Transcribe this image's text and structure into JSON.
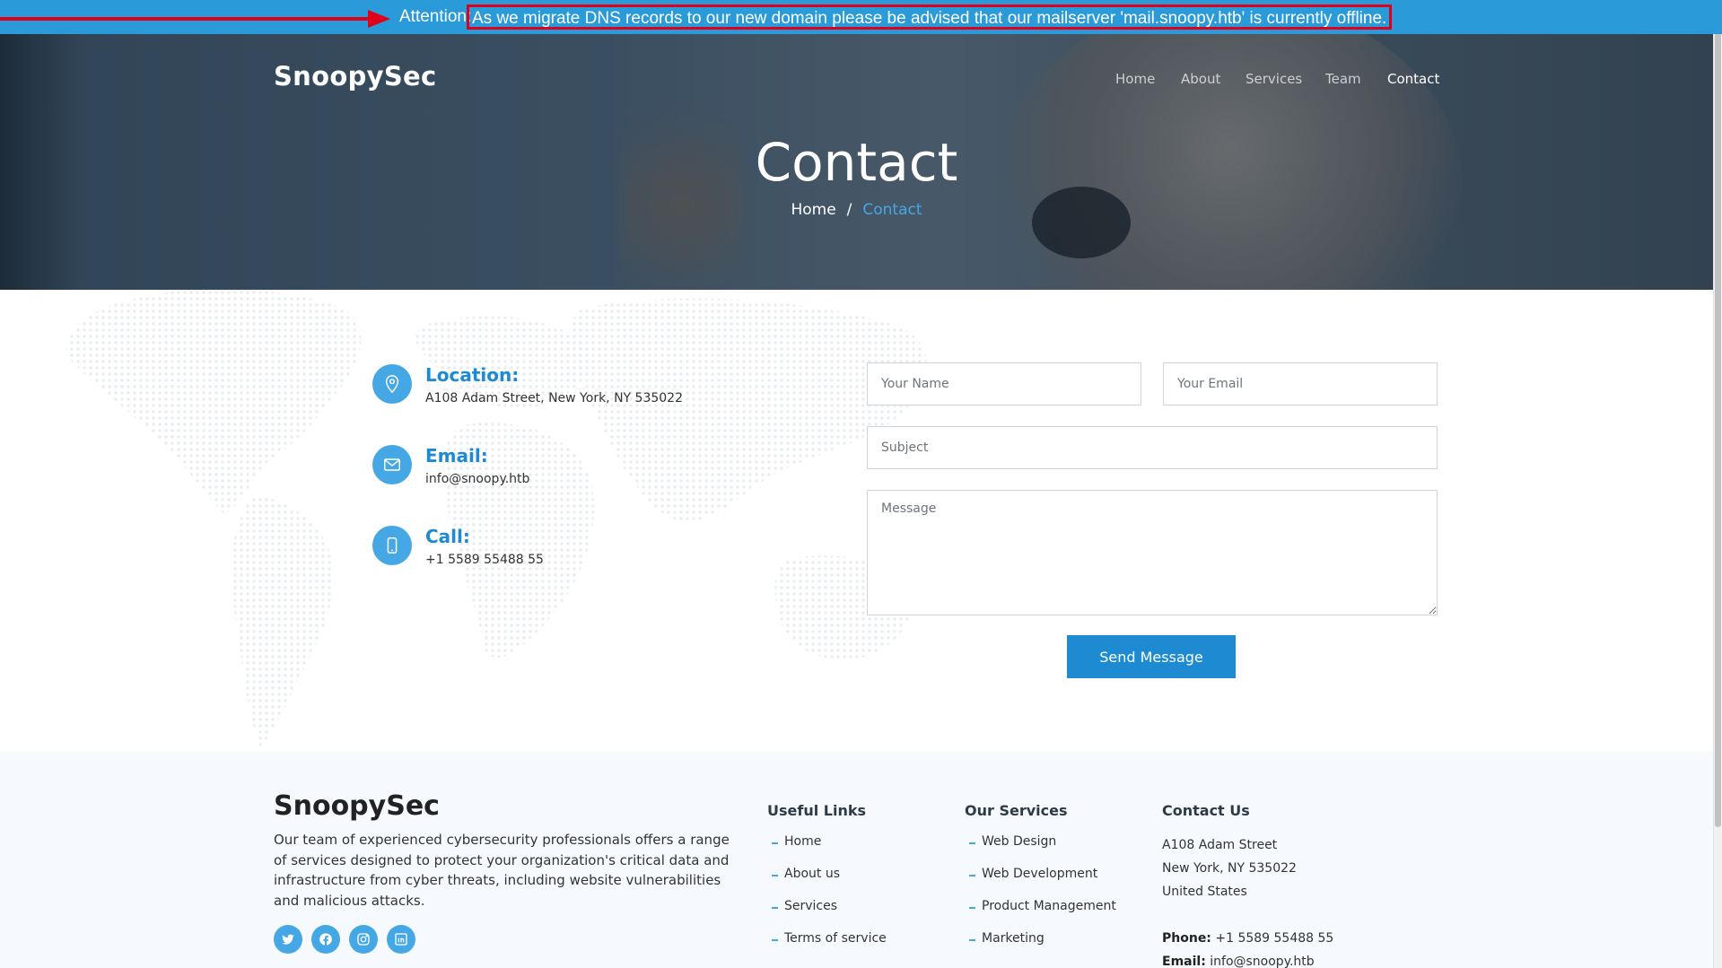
{
  "attention": {
    "label": "Attention:",
    "message": "As we migrate DNS records to our new domain please be advised that our mailserver 'mail.snoopy.htb' is currently offline."
  },
  "brand": {
    "name": "SnoopySec"
  },
  "nav": {
    "items": [
      {
        "label": "Home"
      },
      {
        "label": "About"
      },
      {
        "label": "Services"
      },
      {
        "label": "Team"
      },
      {
        "label": "Contact"
      }
    ],
    "active": "Contact"
  },
  "hero": {
    "title": "Contact",
    "breadcrumb": {
      "home": "Home",
      "separator": "/",
      "current": "Contact"
    }
  },
  "contact_info": {
    "location": {
      "title": "Location:",
      "value": "A108 Adam Street, New York, NY 535022",
      "icon": "map-pin-icon"
    },
    "email": {
      "title": "Email:",
      "value": "info@snoopy.htb",
      "icon": "envelope-icon"
    },
    "call": {
      "title": "Call:",
      "value": "+1 5589 55488 55",
      "icon": "phone-icon"
    }
  },
  "form": {
    "name_placeholder": "Your Name",
    "email_placeholder": "Your Email",
    "subject_placeholder": "Subject",
    "message_placeholder": "Message",
    "submit_label": "Send Message"
  },
  "footer": {
    "brand": "SnoopySec",
    "about": "Our team of experienced cybersecurity professionals offers a range of services designed to protect your organization's critical data and infrastructure from cyber threats, including website vulnerabilities and malicious attacks.",
    "socials": [
      "twitter-icon",
      "facebook-icon",
      "instagram-icon",
      "linkedin-icon"
    ],
    "useful_links": {
      "title": "Useful Links",
      "items": [
        "Home",
        "About us",
        "Services",
        "Terms of service"
      ]
    },
    "our_services": {
      "title": "Our Services",
      "items": [
        "Web Design",
        "Web Development",
        "Product Management",
        "Marketing"
      ]
    },
    "contact_us": {
      "title": "Contact Us",
      "address_line1": "A108 Adam Street",
      "address_line2": "New York, NY 535022",
      "address_line3": "United States",
      "phone_label": "Phone:",
      "phone_value": "+1 5589 55488 55",
      "email_label": "Email:",
      "email_value": "info@snoopy.htb"
    }
  },
  "colors": {
    "attention_bar": "#2b9ad8",
    "accent": "#1d8ad2",
    "accent_light": "#45a7e3",
    "highlight_red": "#e1001a",
    "footer_bg": "#f6f9fd"
  }
}
